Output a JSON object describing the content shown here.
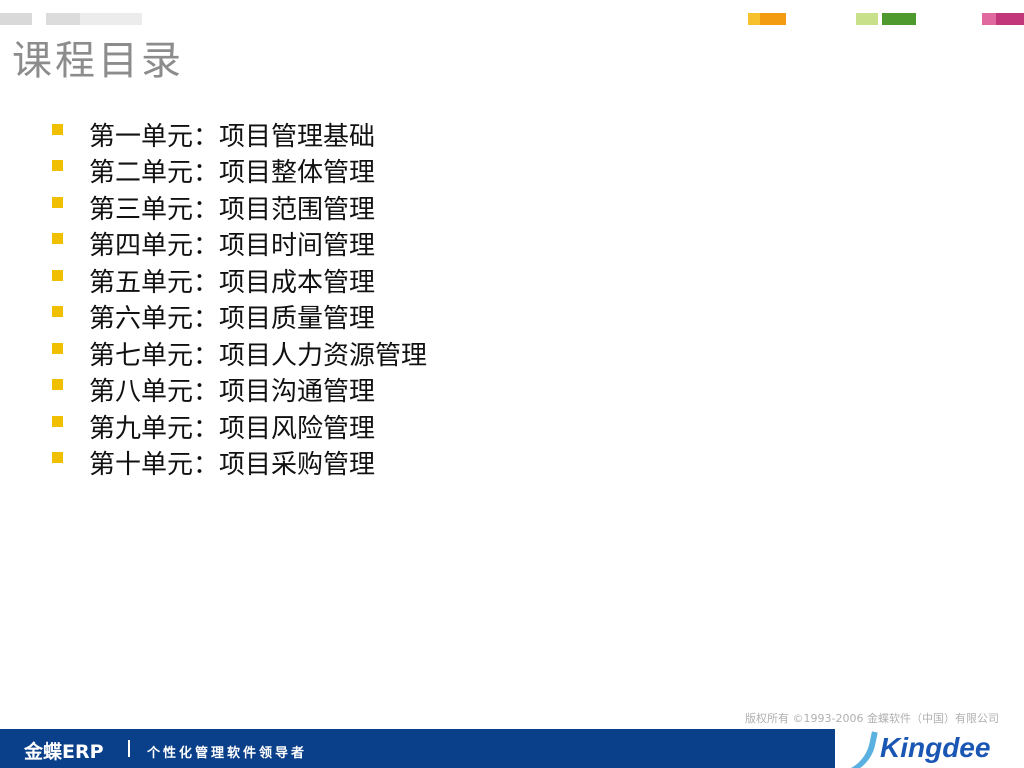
{
  "header": {
    "title": "课程目录",
    "gray_bars": [
      "#d9d9d9",
      "#dcdcdc",
      "#e8e8e8"
    ],
    "color_tabs": [
      {
        "color_a": "#f6c12c",
        "color_b": "#f39c12"
      },
      {
        "color_a": "#c9e08a",
        "color_b": "#4f9a2f"
      },
      {
        "color_a": "#e06aa0",
        "color_b": "#c2367a"
      }
    ]
  },
  "units": [
    "第一单元：项目管理基础",
    "第二单元：项目整体管理",
    "第三单元：项目范围管理",
    "第四单元：项目时间管理",
    "第五单元：项目成本管理",
    "第六单元：项目质量管理",
    "第七单元：项目人力资源管理",
    "第八单元：项目沟通管理",
    "第九单元：项目风险管理",
    "第十单元：项目采购管理"
  ],
  "bullet_color": "#f0c000",
  "footer": {
    "copyright": "版权所有 ©1993-2006 金蝶软件（中国）有限公司",
    "brand": "金蝶ERP",
    "slogan": "个性化管理软件领导者",
    "logo": "Kingdee",
    "bar_color": "#0a3f8a"
  }
}
